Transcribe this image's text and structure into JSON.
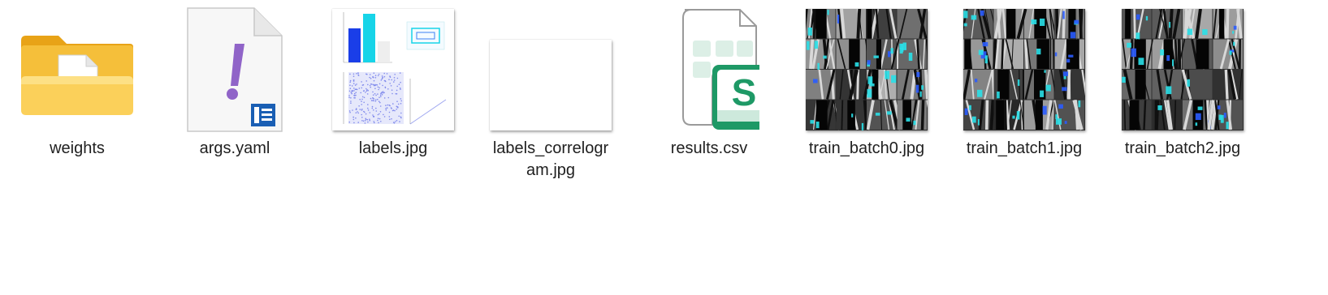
{
  "files": [
    {
      "name": "weights",
      "type": "folder",
      "icon": "folder-icon"
    },
    {
      "name": "args.yaml",
      "type": "yaml",
      "icon": "yaml-file-icon"
    },
    {
      "name": "labels.jpg",
      "type": "image",
      "icon": "labels-thumbnail"
    },
    {
      "name": "labels_correlogram.jpg",
      "type": "image",
      "icon": "blank-image-thumbnail"
    },
    {
      "name": "results.csv",
      "type": "csv",
      "icon": "spreadsheet-file-icon"
    },
    {
      "name": "train_batch0.jpg",
      "type": "image",
      "icon": "train-batch-thumbnail"
    },
    {
      "name": "train_batch1.jpg",
      "type": "image",
      "icon": "train-batch-thumbnail"
    },
    {
      "name": "train_batch2.jpg",
      "type": "image",
      "icon": "train-batch-thumbnail"
    }
  ],
  "colors": {
    "folder": "#f7c948",
    "yaml_mark": "#8a63c9",
    "doc_badge": "#1a5fb4",
    "csv_green": "#1e9966",
    "bar_blue": "#1a3ee8",
    "bar_cyan": "#17d4e8",
    "batch_cyan": "#29e0e8"
  }
}
